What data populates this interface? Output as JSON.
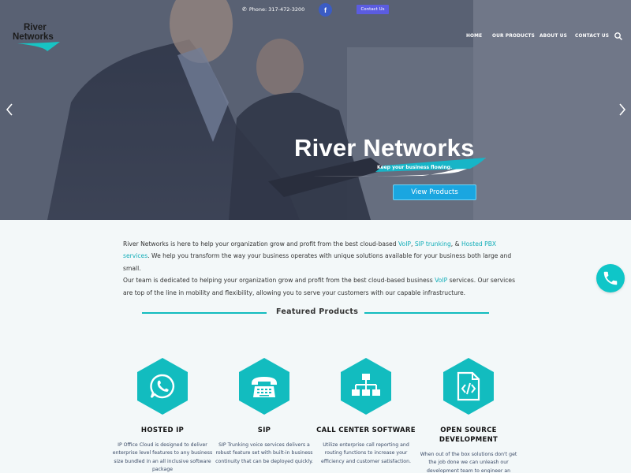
{
  "topbar": {
    "phone_text": "Phone: 317-472-3200",
    "facebook_glyph": "f",
    "contact_label": "Contact Us"
  },
  "logo": {
    "line1": "River",
    "line2": "Networks"
  },
  "nav": {
    "items": [
      {
        "label": "HOME"
      },
      {
        "label": "OUR PRODUCTS"
      },
      {
        "label": "ABOUT US"
      },
      {
        "label": "CONTACT US"
      }
    ]
  },
  "hero": {
    "title": "River Networks",
    "tagline": "Keep your business flowing.",
    "button_label": "View Products"
  },
  "intro": {
    "p1_a": "River Networks is here to help your organization grow and profit from the best cloud-based ",
    "link_voip": "VoIP",
    "p1_b": ", ",
    "link_sip": "SIP trunking",
    "p1_c": ", & ",
    "link_pbx": "Hosted PBX services",
    "p1_d": ".  We help you transform the way your business operates with unique solutions available for your business both large and small.",
    "p2_a": "Our team is dedicated to helping your organization grow and profit from the best cloud-based business ",
    "link_voip2": "VoIP",
    "p2_b": " services. Our services are top of the line in mobility and flexibility, allowing you to serve your customers with our capable infrastructure."
  },
  "featured": {
    "heading": "Featured Products"
  },
  "products": [
    {
      "icon": "whatsapp-icon",
      "title": "HOSTED IP",
      "desc": "IP Office Cloud is designed to deliver enterprise level features to any business size bundled in an all inclusive software package"
    },
    {
      "icon": "telephone-icon",
      "title": "SIP",
      "desc": "SIP Trunking voice services delivers a robust feature set with built-in business continuity that can be deployed quickly."
    },
    {
      "icon": "network-diagram-icon",
      "title": "CALL CENTER SOFTWARE",
      "desc": "Utilize enterprise call reporting and routing functions to increase your efficiency and customer satisfaction."
    },
    {
      "icon": "code-file-icon",
      "title": "OPEN SOURCE DEVELOPMENT",
      "desc": "When out of the box solutions don't get the job done we can unleash our development team to engineer an"
    }
  ],
  "colors": {
    "teal": "#12bcbf",
    "button_blue": "#1aa6e0",
    "contact_purple": "#5b5ce0",
    "facebook_blue": "#3b5cc4"
  }
}
